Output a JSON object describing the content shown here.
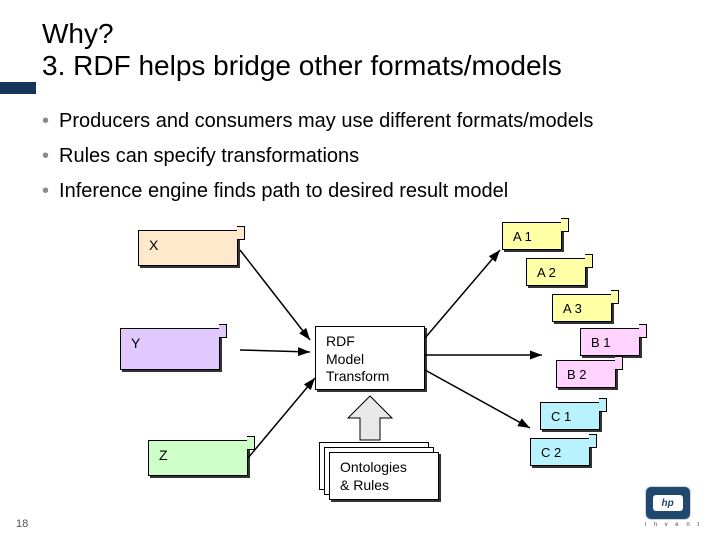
{
  "title_line1": "Why?",
  "title_line2": "3. RDF helps bridge other formats/models",
  "bullets": [
    "Producers and consumers may use different formats/models",
    "Rules can specify transformations",
    "Inference engine finds path to desired result model"
  ],
  "boxes": {
    "x": "X",
    "y": "Y",
    "z": "Z",
    "rdf_l1": "RDF",
    "rdf_l2": "Model",
    "rdf_l3": "Transform",
    "ont_l1": "Ontologies",
    "ont_l2": "& Rules",
    "a1": "A 1",
    "a2": "A 2",
    "a3": "A 3",
    "b1": "B 1",
    "b2": "B 2",
    "c1": "C 1",
    "c2": "C 2"
  },
  "logo": {
    "text": "hp",
    "sub": "i n v e n t"
  },
  "page_number": "18"
}
